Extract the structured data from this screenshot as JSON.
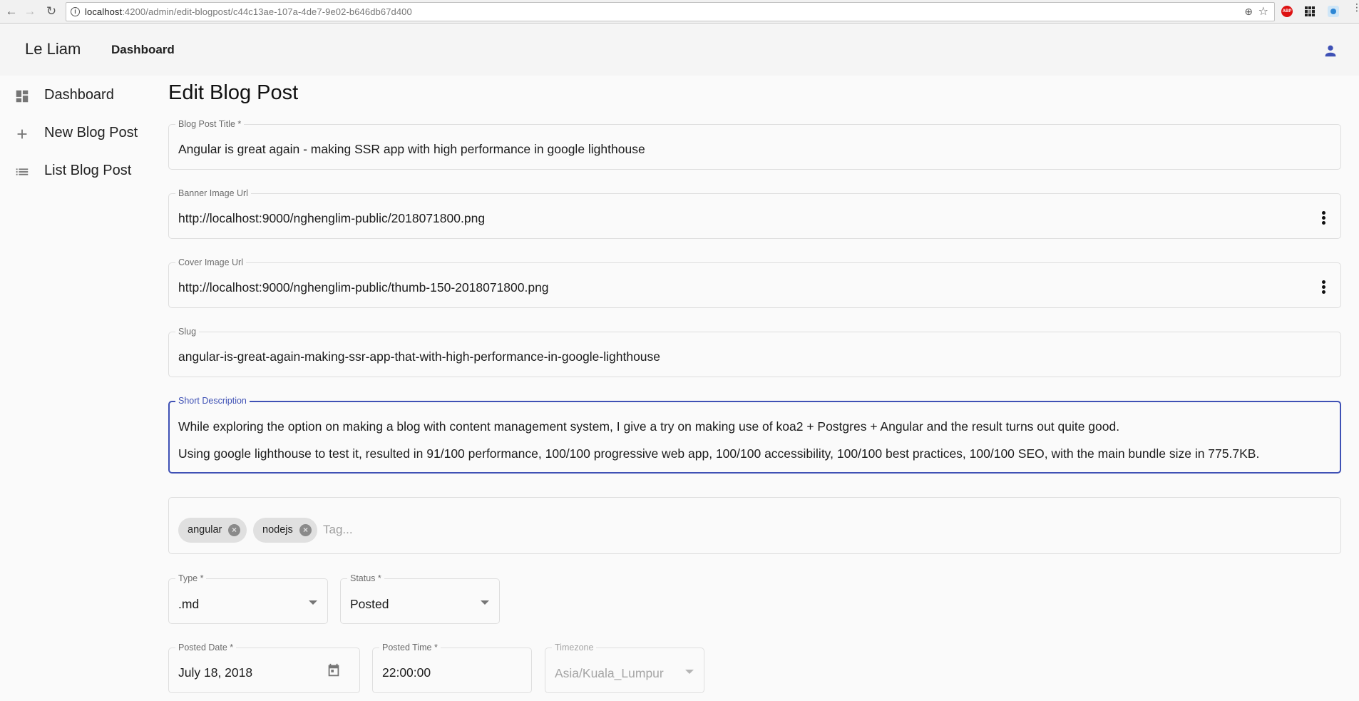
{
  "browser": {
    "url_host": "localhost",
    "url_rest": ":4200/admin/edit-blogpost/c44c13ae-107a-4de7-9e02-b646db67d400",
    "extensions": [
      "zoom-icon",
      "bookmark-star-icon",
      "adblock-plus-icon",
      "apps-grid-icon",
      "extension-icon",
      "chrome-menu-icon"
    ],
    "abp_label": "ABP"
  },
  "toolbar": {
    "brand": "Le Liam",
    "nav_link": "Dashboard",
    "account_icon": "account-icon",
    "accent_color": "#3f51b5"
  },
  "sidebar": {
    "items": [
      {
        "label": "Dashboard",
        "icon": "dashboard-icon"
      },
      {
        "label": "New Blog Post",
        "icon": "plus-icon"
      },
      {
        "label": "List Blog Post",
        "icon": "list-icon"
      }
    ]
  },
  "page": {
    "title": "Edit Blog Post"
  },
  "form": {
    "title": {
      "label": "Blog Post Title *",
      "value": "Angular is great again - making SSR app with high performance in google lighthouse"
    },
    "banner": {
      "label": "Banner Image Url",
      "value": "http://localhost:9000/nghenglim-public/2018071800.png"
    },
    "cover": {
      "label": "Cover Image Url",
      "value": "http://localhost:9000/nghenglim-public/thumb-150-2018071800.png"
    },
    "slug": {
      "label": "Slug",
      "value": "angular-is-great-again-making-ssr-app-that-with-high-performance-in-google-lighthouse"
    },
    "short_description": {
      "label": "Short Description",
      "lines": [
        "While exploring the option on making a blog with content management system, I give a try on making use of koa2 + Postgres + Angular and the result turns out quite good.",
        "Using google lighthouse to test it, resulted in 91/100 performance, 100/100 progressive web app, 100/100 accessibility, 100/100 best practices, 100/100 SEO, with the main bundle size in 775.7KB."
      ]
    },
    "tags": {
      "chips": [
        "angular",
        "nodejs"
      ],
      "remove_glyph": "×",
      "placeholder": "Tag..."
    },
    "type": {
      "label": "Type *",
      "value": ".md"
    },
    "status": {
      "label": "Status *",
      "value": "Posted"
    },
    "posted_date": {
      "label": "Posted Date *",
      "value": "July 18, 2018"
    },
    "posted_time": {
      "label": "Posted Time *",
      "value": "22:00:00"
    },
    "timezone": {
      "label": "Timezone",
      "value": "Asia/Kuala_Lumpur",
      "disabled": true
    }
  }
}
